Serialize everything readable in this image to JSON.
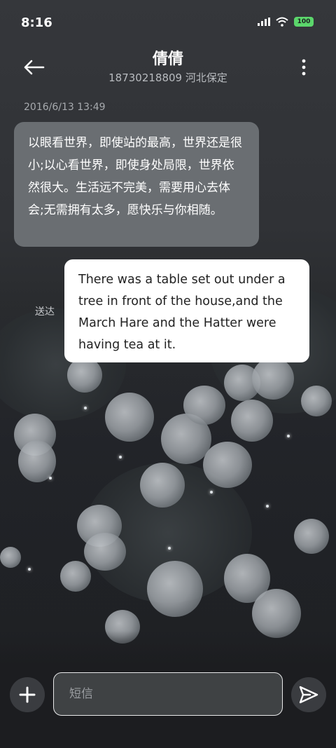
{
  "status_bar": {
    "time": "8:16",
    "battery": "100",
    "icons": [
      "signal-icon",
      "wifi-icon",
      "battery-icon"
    ]
  },
  "header": {
    "contact_name": "倩倩",
    "contact_number_location": "18730218809 河北保定",
    "back_icon": "arrow-left-icon",
    "menu_icon": "more-vertical-icon"
  },
  "conversation": {
    "timestamp": "2016/6/13 13:49",
    "incoming_message": "以眼看世界，即使站的最高，世界还是很小;以心看世界，即使身处局限，世界依然很大。生活远不完美，需要用心去体会;无需拥有太多，愿快乐与你相随。",
    "outgoing_message": "There was a table set out under a tree in front of the house,and the March Hare and the Hatter were having tea at it.",
    "outgoing_status": "送达"
  },
  "composer": {
    "placeholder": "短信",
    "add_icon": "plus-icon",
    "send_icon": "send-icon"
  },
  "colors": {
    "background": "#2f3135",
    "incoming_bubble": "#6a6e72",
    "outgoing_bubble": "#ffffff",
    "battery": "#5bd66b"
  }
}
